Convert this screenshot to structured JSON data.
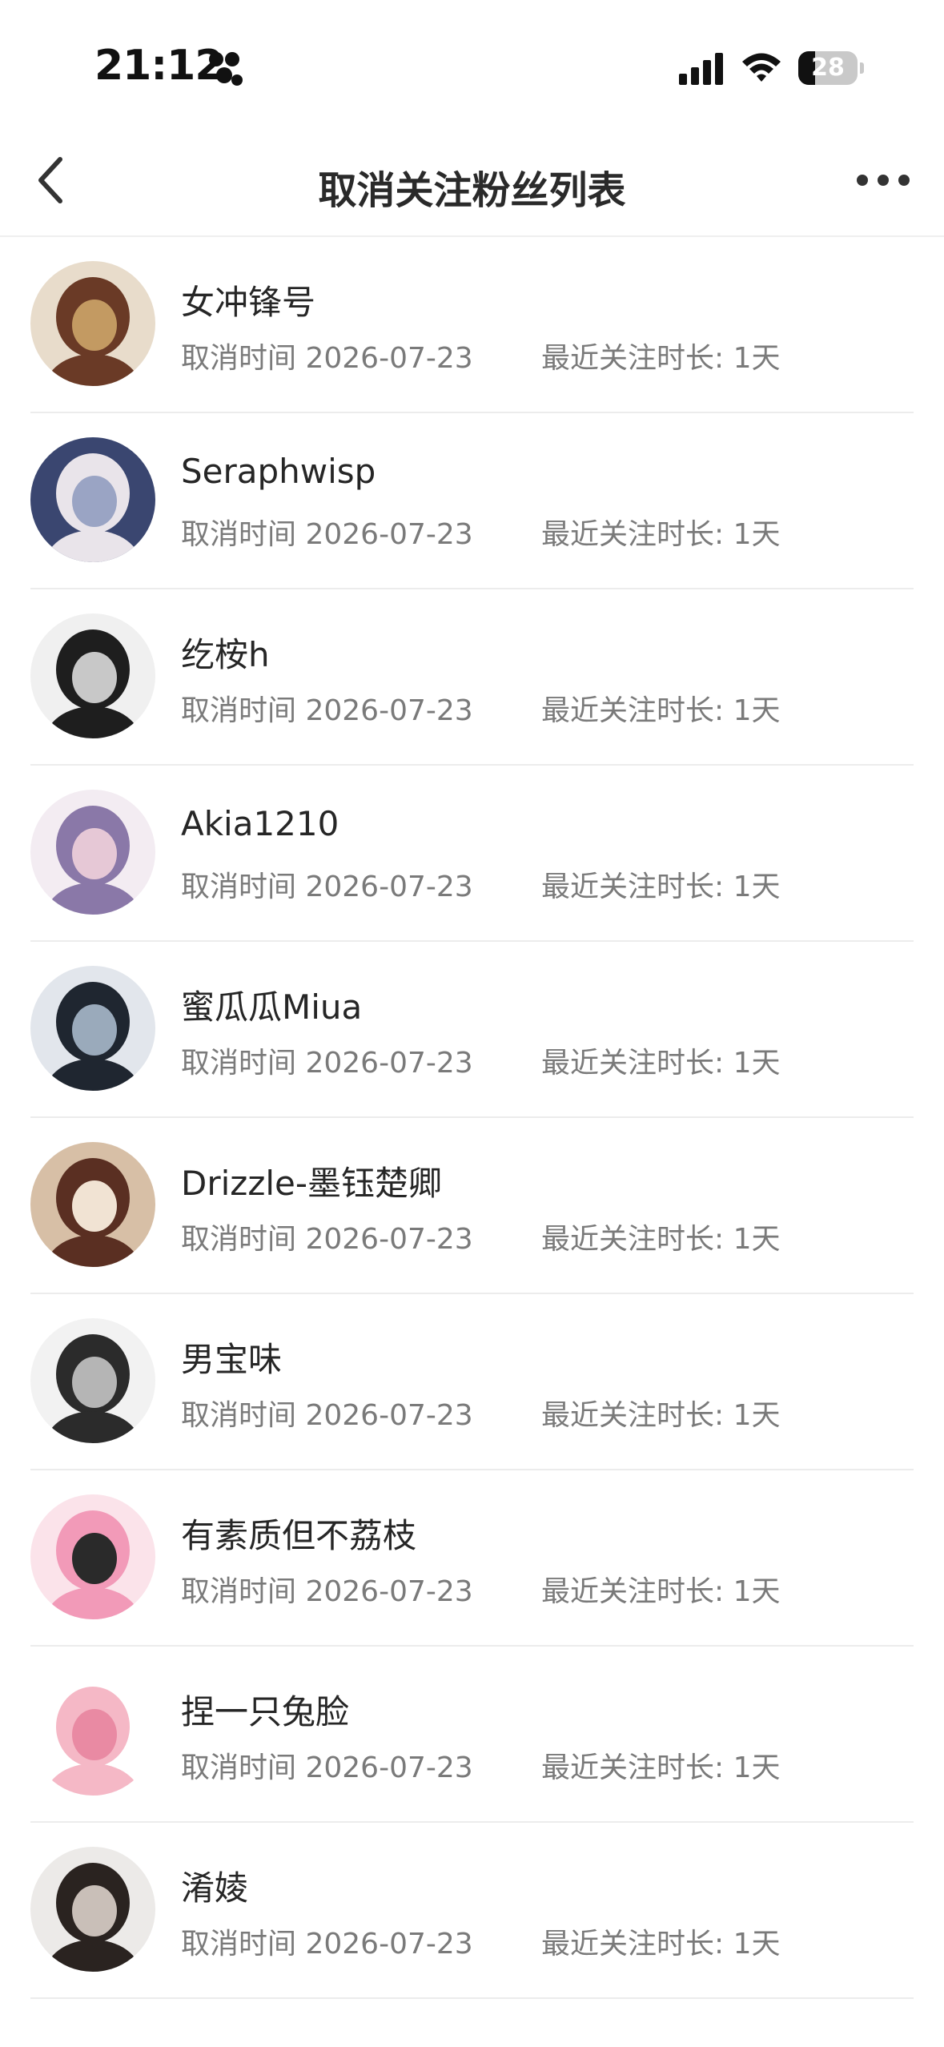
{
  "status_bar": {
    "time": "21:12",
    "battery": "28",
    "battery_level": 0.28
  },
  "nav": {
    "title": "取消关注粉丝列表"
  },
  "fans": [
    {
      "name": "女冲锋号",
      "unfollow_label": "取消时间",
      "unfollow_date": "2026-07-23",
      "duration_label": "最近关注时长:",
      "duration": "1天",
      "avatar_colors": [
        "#e8dccb",
        "#6a3a26",
        "#c39a62"
      ]
    },
    {
      "name": "Seraphwisp",
      "unfollow_label": "取消时间",
      "unfollow_date": "2026-07-23",
      "duration_label": "最近关注时长:",
      "duration": "1天",
      "avatar_colors": [
        "#3a4670",
        "#e9e4ea",
        "#9aa4c4"
      ]
    },
    {
      "name": "纥桉h",
      "unfollow_label": "取消时间",
      "unfollow_date": "2026-07-23",
      "duration_label": "最近关注时长:",
      "duration": "1天",
      "avatar_colors": [
        "#f0f0f0",
        "#1e1e1e",
        "#c8c8c8"
      ]
    },
    {
      "name": "Akia1210",
      "unfollow_label": "取消时间",
      "unfollow_date": "2026-07-23",
      "duration_label": "最近关注时长:",
      "duration": "1天",
      "avatar_colors": [
        "#f3ecf2",
        "#8a78a8",
        "#e6c8d6"
      ]
    },
    {
      "name": "蜜瓜瓜Miua",
      "unfollow_label": "取消时间",
      "unfollow_date": "2026-07-23",
      "duration_label": "最近关注时长:",
      "duration": "1天",
      "avatar_colors": [
        "#e2e6ec",
        "#1f2630",
        "#9aaabb"
      ]
    },
    {
      "name": "Drizzle-墨钰楚卿",
      "unfollow_label": "取消时间",
      "unfollow_date": "2026-07-23",
      "duration_label": "最近关注时长:",
      "duration": "1天",
      "avatar_colors": [
        "#d7bfa6",
        "#5a2f22",
        "#f1e3d3"
      ]
    },
    {
      "name": "男宝味",
      "unfollow_label": "取消时间",
      "unfollow_date": "2026-07-23",
      "duration_label": "最近关注时长:",
      "duration": "1天",
      "avatar_colors": [
        "#f2f2f2",
        "#2b2b2b",
        "#b5b5b5"
      ]
    },
    {
      "name": "有素质但不荔枝",
      "unfollow_label": "取消时间",
      "unfollow_date": "2026-07-23",
      "duration_label": "最近关注时长:",
      "duration": "1天",
      "avatar_colors": [
        "#fbe3ea",
        "#f29ab8",
        "#2a2a2a"
      ]
    },
    {
      "name": "捏一只兔脸",
      "unfollow_label": "取消时间",
      "unfollow_date": "2026-07-23",
      "duration_label": "最近关注时长:",
      "duration": "1天",
      "avatar_colors": [
        "#ffffff",
        "#f5b8c6",
        "#e98aa3"
      ]
    },
    {
      "name": "淆婈",
      "unfollow_label": "取消时间",
      "unfollow_date": "2026-07-23",
      "duration_label": "最近关注时长:",
      "duration": "1天",
      "avatar_colors": [
        "#eceae8",
        "#2a2320",
        "#c9bfb8"
      ]
    }
  ]
}
